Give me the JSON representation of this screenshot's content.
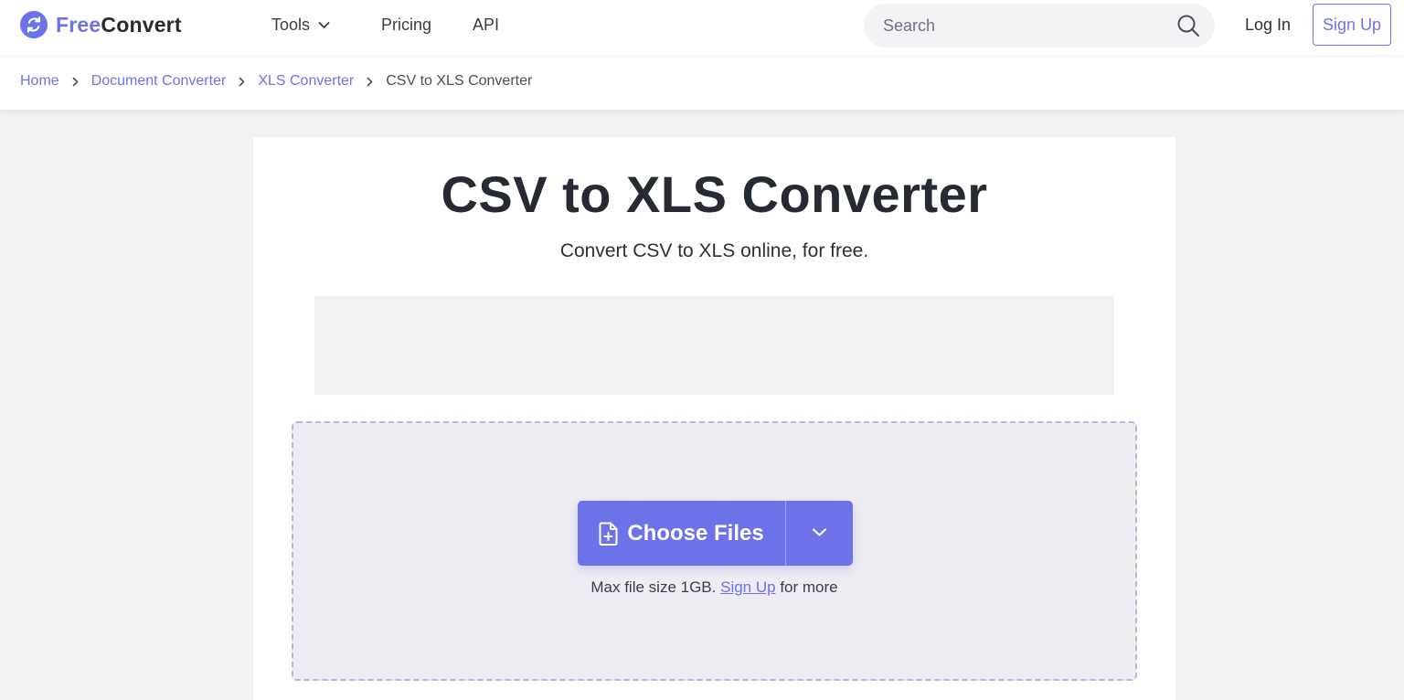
{
  "brand": {
    "part1": "Free",
    "part2": "Convert",
    "accent": "#6c72e8"
  },
  "nav": {
    "tools": "Tools",
    "pricing": "Pricing",
    "api": "API"
  },
  "search": {
    "placeholder": "Search"
  },
  "auth": {
    "login": "Log In",
    "signup": "Sign Up"
  },
  "breadcrumb": {
    "items": [
      "Home",
      "Document Converter",
      "XLS Converter"
    ],
    "current": "CSV to XLS Converter"
  },
  "page": {
    "title": "CSV to XLS Converter",
    "subtitle": "Convert CSV to XLS online, for free."
  },
  "upload": {
    "button_label": "Choose Files",
    "max_prefix": "Max file size 1GB.",
    "signup_link": "Sign Up",
    "max_suffix": "for more"
  },
  "icons": [
    "refresh-logo-icon",
    "chevron-down-icon",
    "search-icon",
    "chevron-right-icon",
    "file-plus-icon"
  ]
}
